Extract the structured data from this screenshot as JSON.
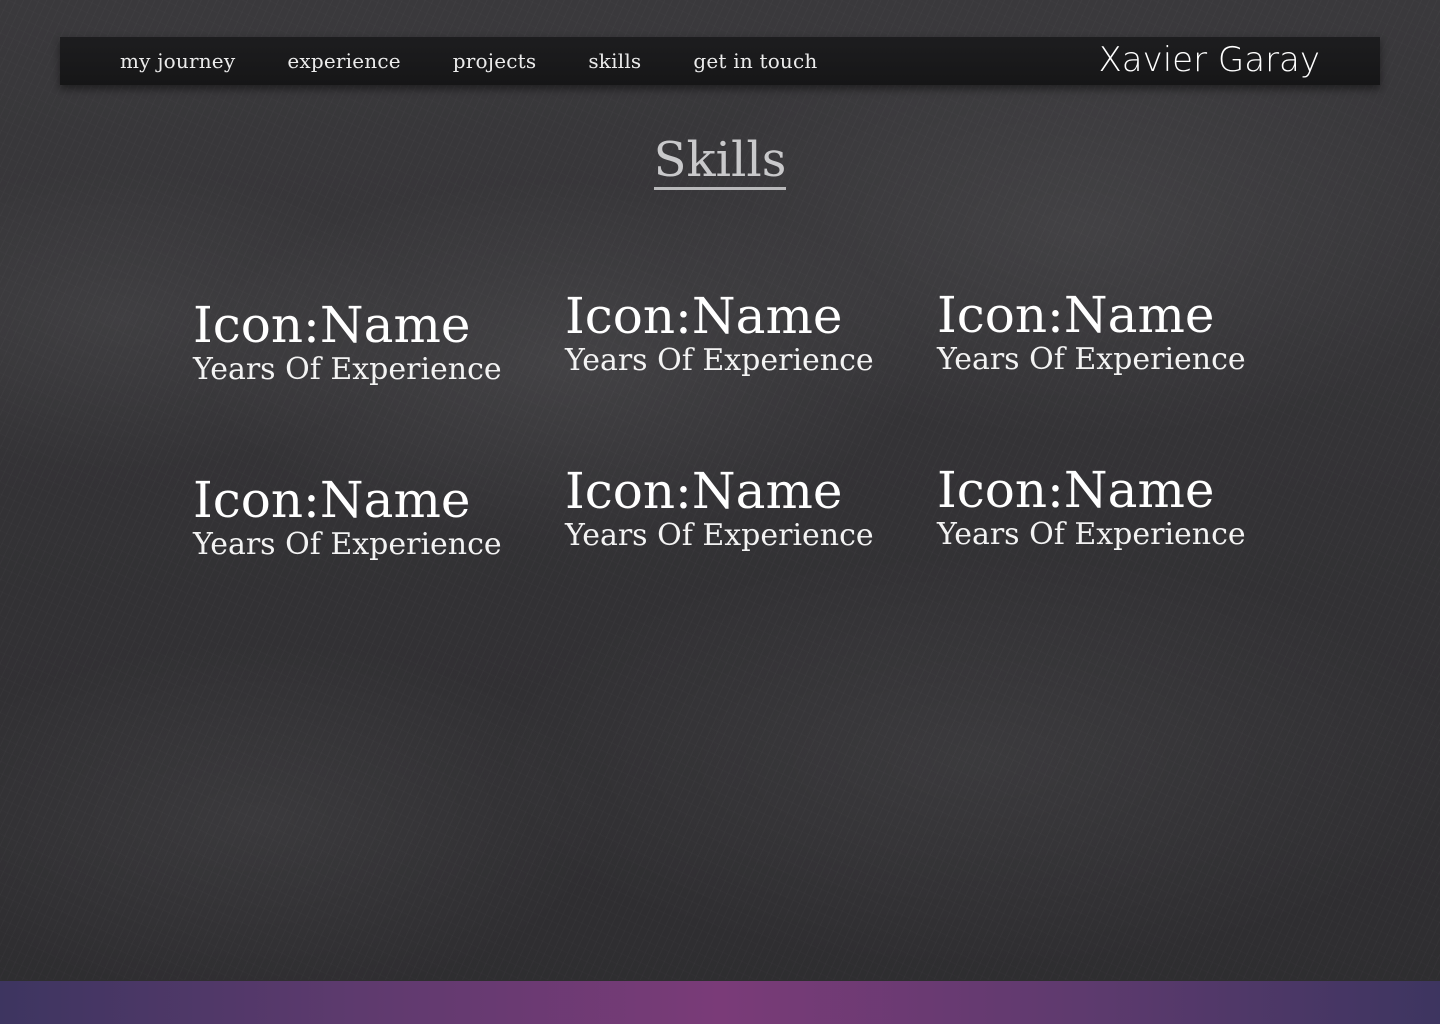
{
  "nav": {
    "links": [
      "my journey",
      "experience",
      "projects",
      "skills",
      "get in touch"
    ],
    "brand": "Xavier Garay"
  },
  "main": {
    "title": "Skills",
    "skills": [
      {
        "name": "Icon:Name",
        "years": "Years Of Experience"
      },
      {
        "name": "Icon:Name",
        "years": "Years Of Experience"
      },
      {
        "name": "Icon:Name",
        "years": "Years Of Experience"
      },
      {
        "name": "Icon:Name",
        "years": "Years Of Experience"
      },
      {
        "name": "Icon:Name",
        "years": "Years Of Experience"
      },
      {
        "name": "Icon:Name",
        "years": "Years Of Experience"
      }
    ]
  },
  "colors": {
    "background": "#333235",
    "navbar": "#1a1a1b",
    "footer_accent": "#7a3b78"
  }
}
